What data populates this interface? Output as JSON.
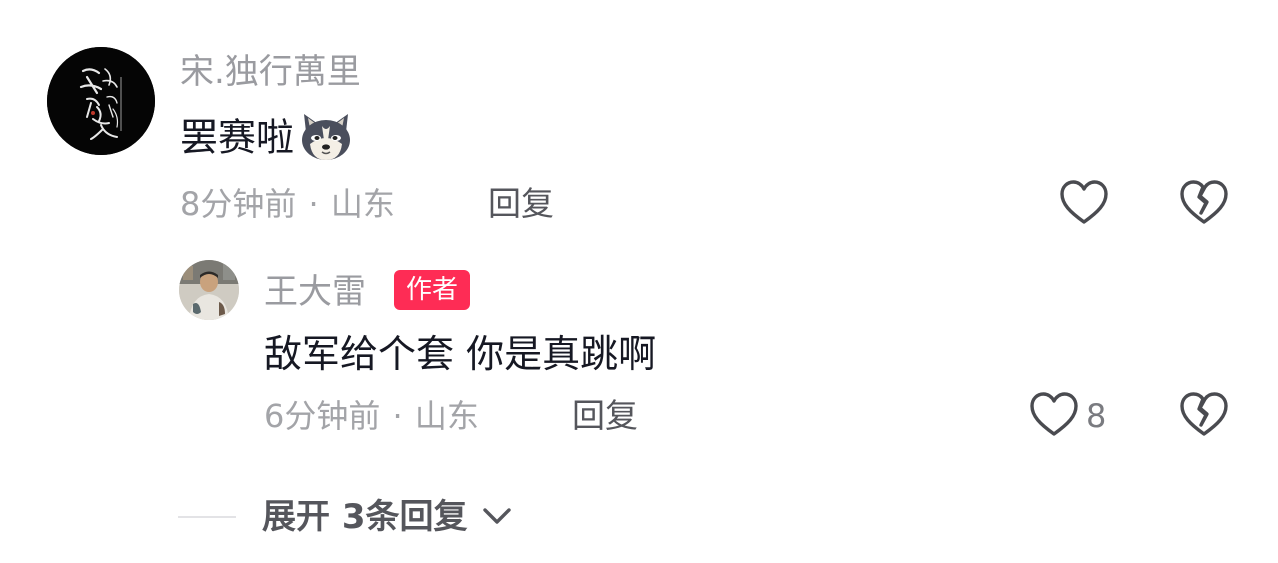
{
  "comment": {
    "username": "宋.独行萬里",
    "text": "罢赛啦",
    "emoji": "dog-emoji",
    "time": "8分钟前",
    "separator": "·",
    "location": "山东",
    "reply_label": "回复"
  },
  "reply": {
    "username": "王大雷",
    "badge": "作者",
    "text": "敌军给个套 你是真跳啊",
    "time": "6分钟前",
    "separator": "·",
    "location": "山东",
    "reply_label": "回复",
    "like_count": "8"
  },
  "expand": {
    "label": "展开 3条回复"
  },
  "colors": {
    "badge": "#fe2c55",
    "muted_text": "#9a9ba0",
    "primary_text": "#161823",
    "icon": "#4a4b50"
  },
  "icons": [
    "heart-icon",
    "broken-heart-icon",
    "chevron-down-icon"
  ]
}
